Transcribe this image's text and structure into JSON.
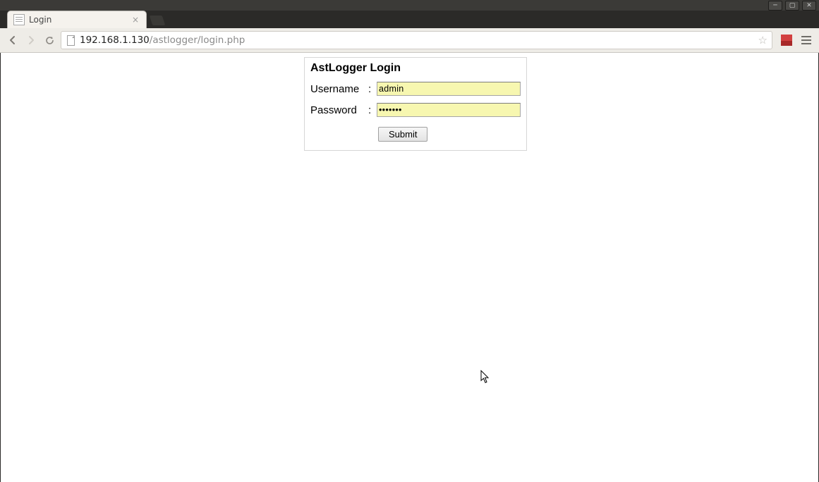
{
  "window": {
    "tab_title": "Login",
    "url_host": "192.168.1.130",
    "url_path": "/astlogger/login.php"
  },
  "login": {
    "title": "AstLogger Login",
    "username_label": "Username",
    "password_label": "Password",
    "colon": ":",
    "username_value": "admin",
    "password_value": "•••••••",
    "submit_label": "Submit"
  }
}
